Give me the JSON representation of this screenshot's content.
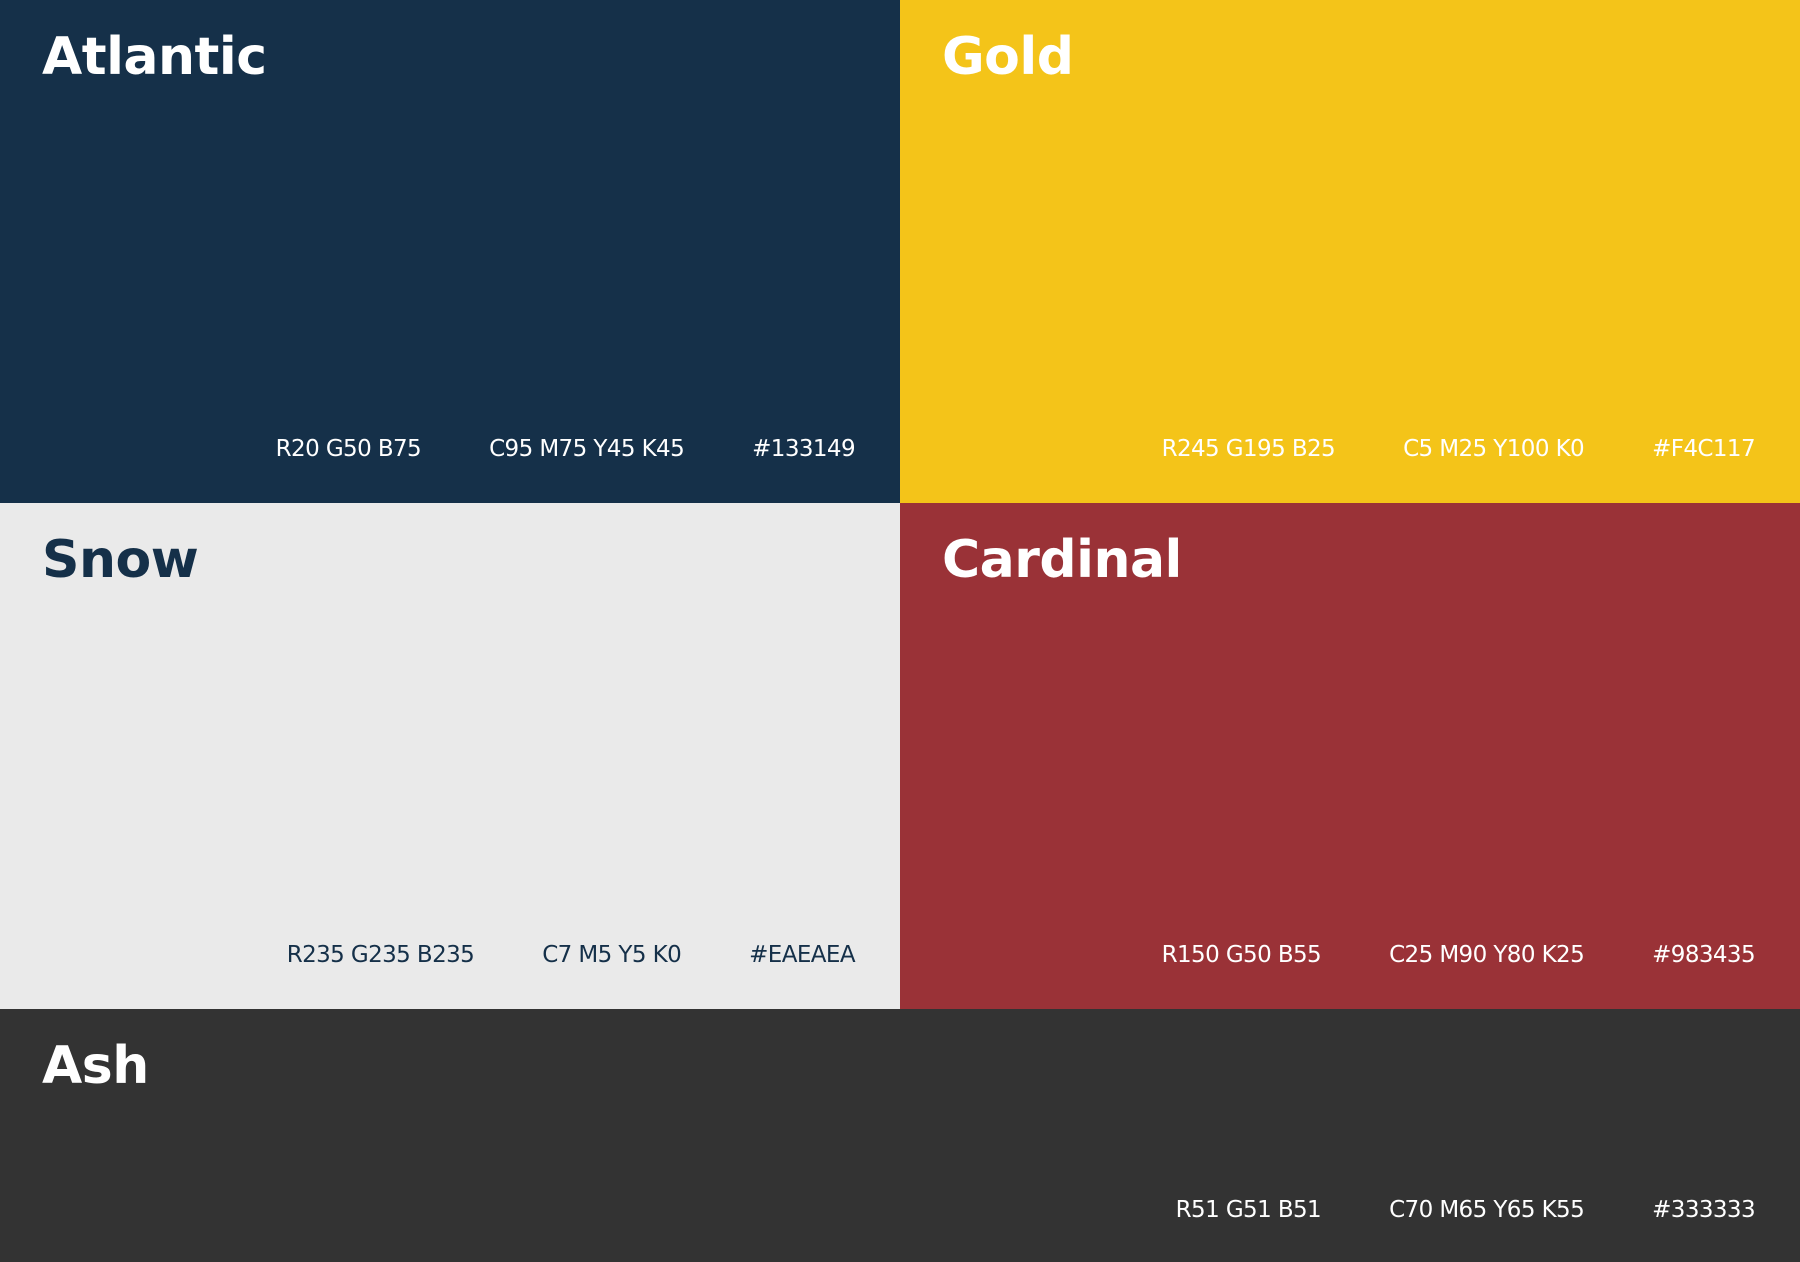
{
  "swatches": [
    {
      "name": "Atlantic",
      "rgb": "R20 G50 B75",
      "cmyk": "C95 M75 Y45 K45",
      "hex": "#133149",
      "background": "#153049",
      "text_color": "#FFFFFF"
    },
    {
      "name": "Gold",
      "rgb": "R245 G195 B25",
      "cmyk": "C5 M25 Y100 K0",
      "hex": "#F4C117",
      "background": "#F4C419",
      "text_color": "#FFFFFF"
    },
    {
      "name": "Snow",
      "rgb": "R235 G235 B235",
      "cmyk": "C7 M5 Y5 K0",
      "hex": "#EAEAEA",
      "background": "#EAEAEA",
      "text_color": "#153049"
    },
    {
      "name": "Cardinal",
      "rgb": "R150 G50 B55",
      "cmyk": "C25 M90 Y80 K25",
      "hex": "#983435",
      "background": "#9A3237",
      "text_color": "#FFFFFF"
    },
    {
      "name": "Ash",
      "rgb": "R51 G51 B51",
      "cmyk": "C70 M65 Y65 K55",
      "hex": "#333333",
      "background": "#333333",
      "text_color": "#FFFFFF"
    }
  ]
}
